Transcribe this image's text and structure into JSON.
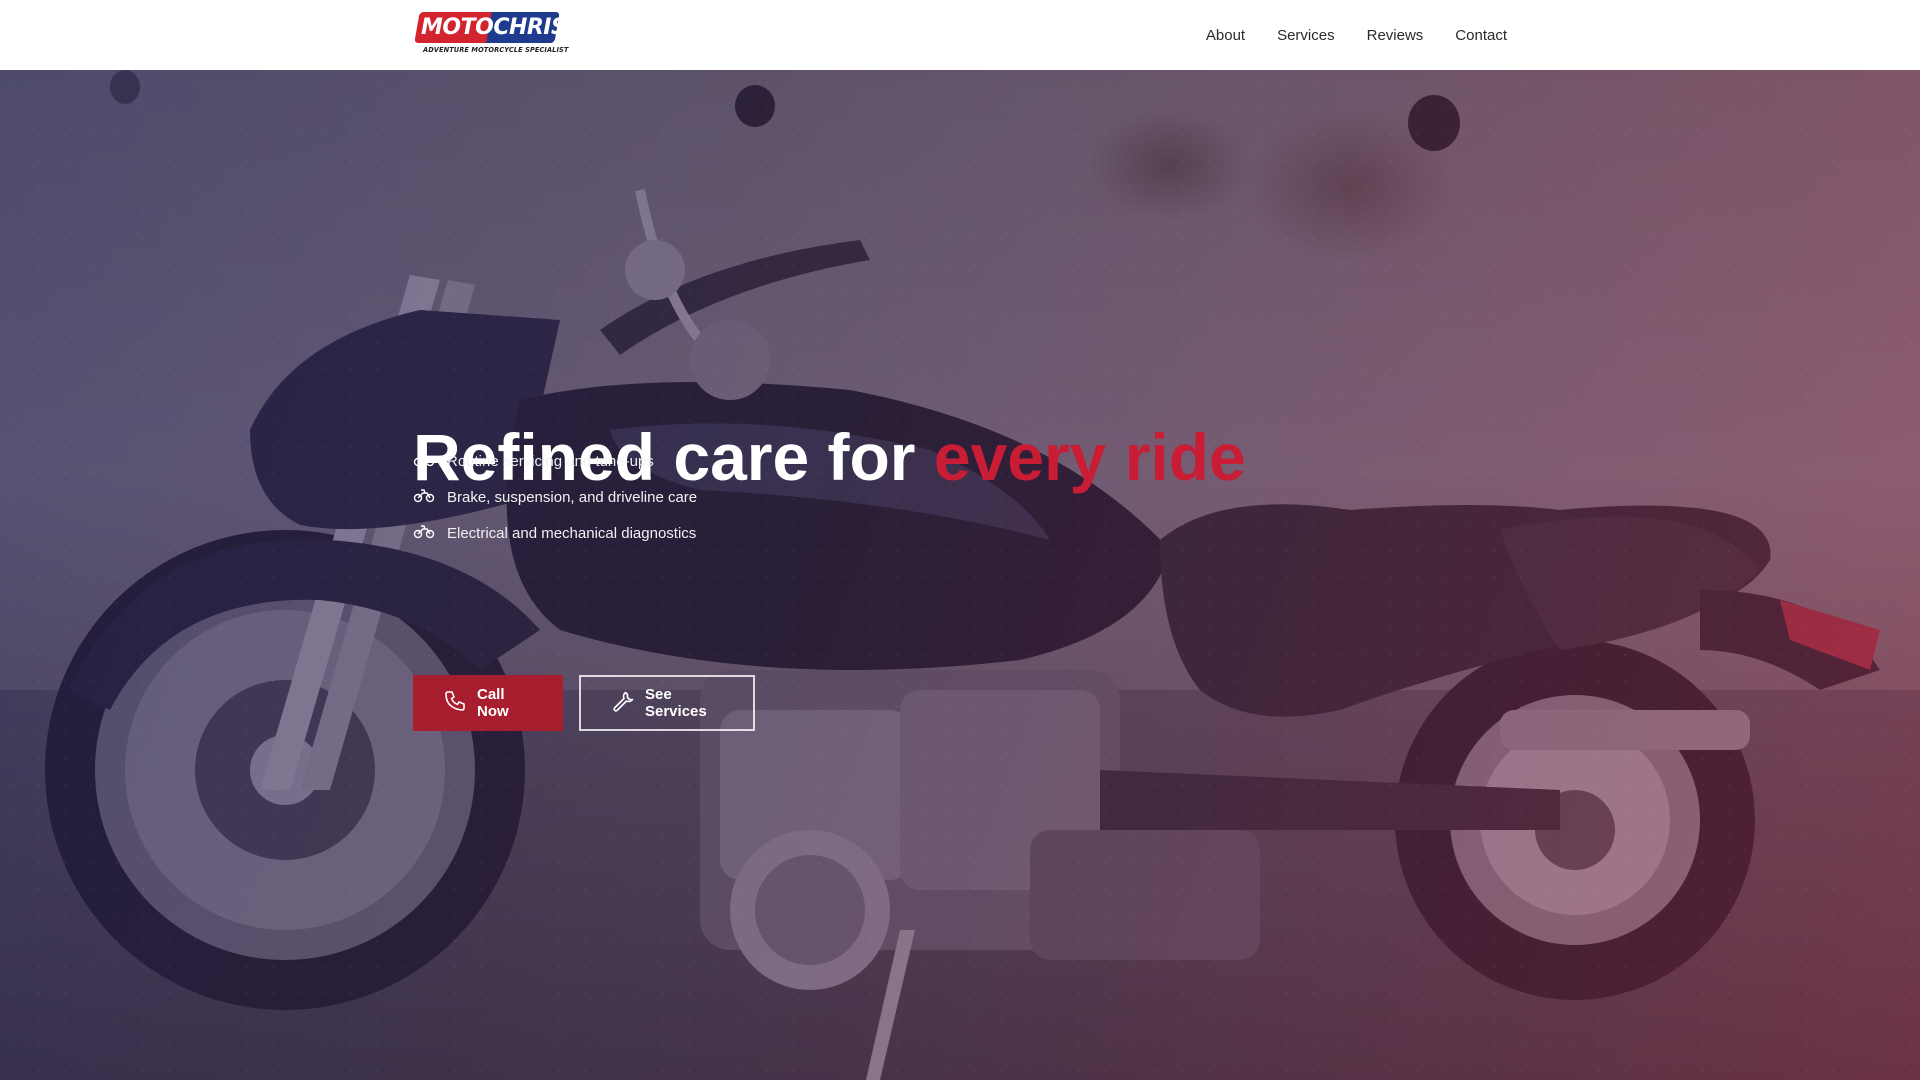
{
  "brand": {
    "logo_primary": "MOTO",
    "logo_secondary": "CHRIS",
    "logo_tagline": "ADVENTURE MOTORCYCLE SPECIALIST",
    "primary_color": "#d2232f",
    "secondary_color": "#1f3b8e"
  },
  "nav": {
    "items": [
      {
        "label": "About"
      },
      {
        "label": "Services"
      },
      {
        "label": "Reviews"
      },
      {
        "label": "Contact"
      }
    ]
  },
  "hero": {
    "headline_main": "Refined care for ",
    "headline_accent": "every ride",
    "accent_color": "#c81d35",
    "features": [
      {
        "icon": "motorcycle-icon",
        "text": "Routine servicing and tune-ups"
      },
      {
        "icon": "motorcycle-icon",
        "text": "Brake, suspension, and driveline care"
      },
      {
        "icon": "motorcycle-icon",
        "text": "Electrical and mechanical diagnostics"
      }
    ],
    "primary_button": {
      "icon": "phone-icon",
      "label": "Call Now"
    },
    "secondary_button": {
      "icon": "wrench-icon",
      "label": "See Services"
    }
  }
}
